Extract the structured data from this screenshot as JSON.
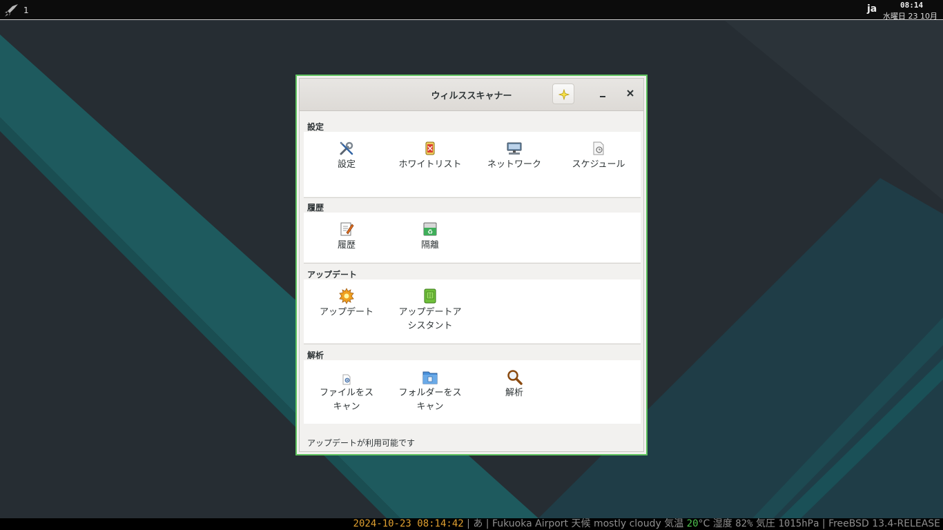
{
  "top_panel": {
    "workspace": "1",
    "lang": "ja",
    "time": "08:14",
    "date": "水曜日 23 10月"
  },
  "window": {
    "title": "ウィルススキャナー",
    "sections": [
      {
        "header": "設定",
        "items": [
          {
            "label": "設定",
            "icon": "tools-icon"
          },
          {
            "label": "ホワイトリスト",
            "icon": "whitelist-icon"
          },
          {
            "label": "ネットワーク",
            "icon": "network-icon"
          },
          {
            "label": "スケジュール",
            "icon": "schedule-icon"
          }
        ]
      },
      {
        "header": "履歴",
        "items": [
          {
            "label": "履歴",
            "icon": "history-icon"
          },
          {
            "label": "隔離",
            "icon": "quarantine-icon"
          }
        ]
      },
      {
        "header": "アップデート",
        "items": [
          {
            "label": "アップデート",
            "icon": "update-icon"
          },
          {
            "label": "アップデートア\nシスタント",
            "label_lines": [
              "アップデートア",
              "シスタント"
            ],
            "icon": "update-assistant-icon"
          }
        ]
      },
      {
        "header": "解析",
        "items": [
          {
            "label_lines": [
              "ファイルをス",
              "キャン"
            ],
            "icon": "scan-file-icon"
          },
          {
            "label_lines": [
              "フォルダーをス",
              "キャン"
            ],
            "icon": "scan-folder-icon"
          },
          {
            "label": "解析",
            "icon": "magnifier-icon"
          }
        ]
      }
    ],
    "status": "アップデートが利用可能です"
  },
  "status_bar": {
    "datetime": "2024-10-23 08:14:42",
    "sep1": " | ",
    "ime": "あ",
    "sep2": " | ",
    "location": "Fukuoka Airport",
    "weather_label": " 天候 ",
    "weather": "mostly cloudy",
    "temp_label": " 気温 ",
    "temp": "20",
    "temp_unit": "°C",
    "humidity_label": " 湿度 ",
    "humidity": "82%",
    "pressure_label": " 気圧 ",
    "pressure": "1015hPa",
    "sep3": " | ",
    "os": "FreeBSD 13.4-RELEASE"
  },
  "colors": {
    "accent_border": "#5fc35f",
    "desktop_bg": "#262d33",
    "teal_stripe": "#1d5a5e"
  }
}
